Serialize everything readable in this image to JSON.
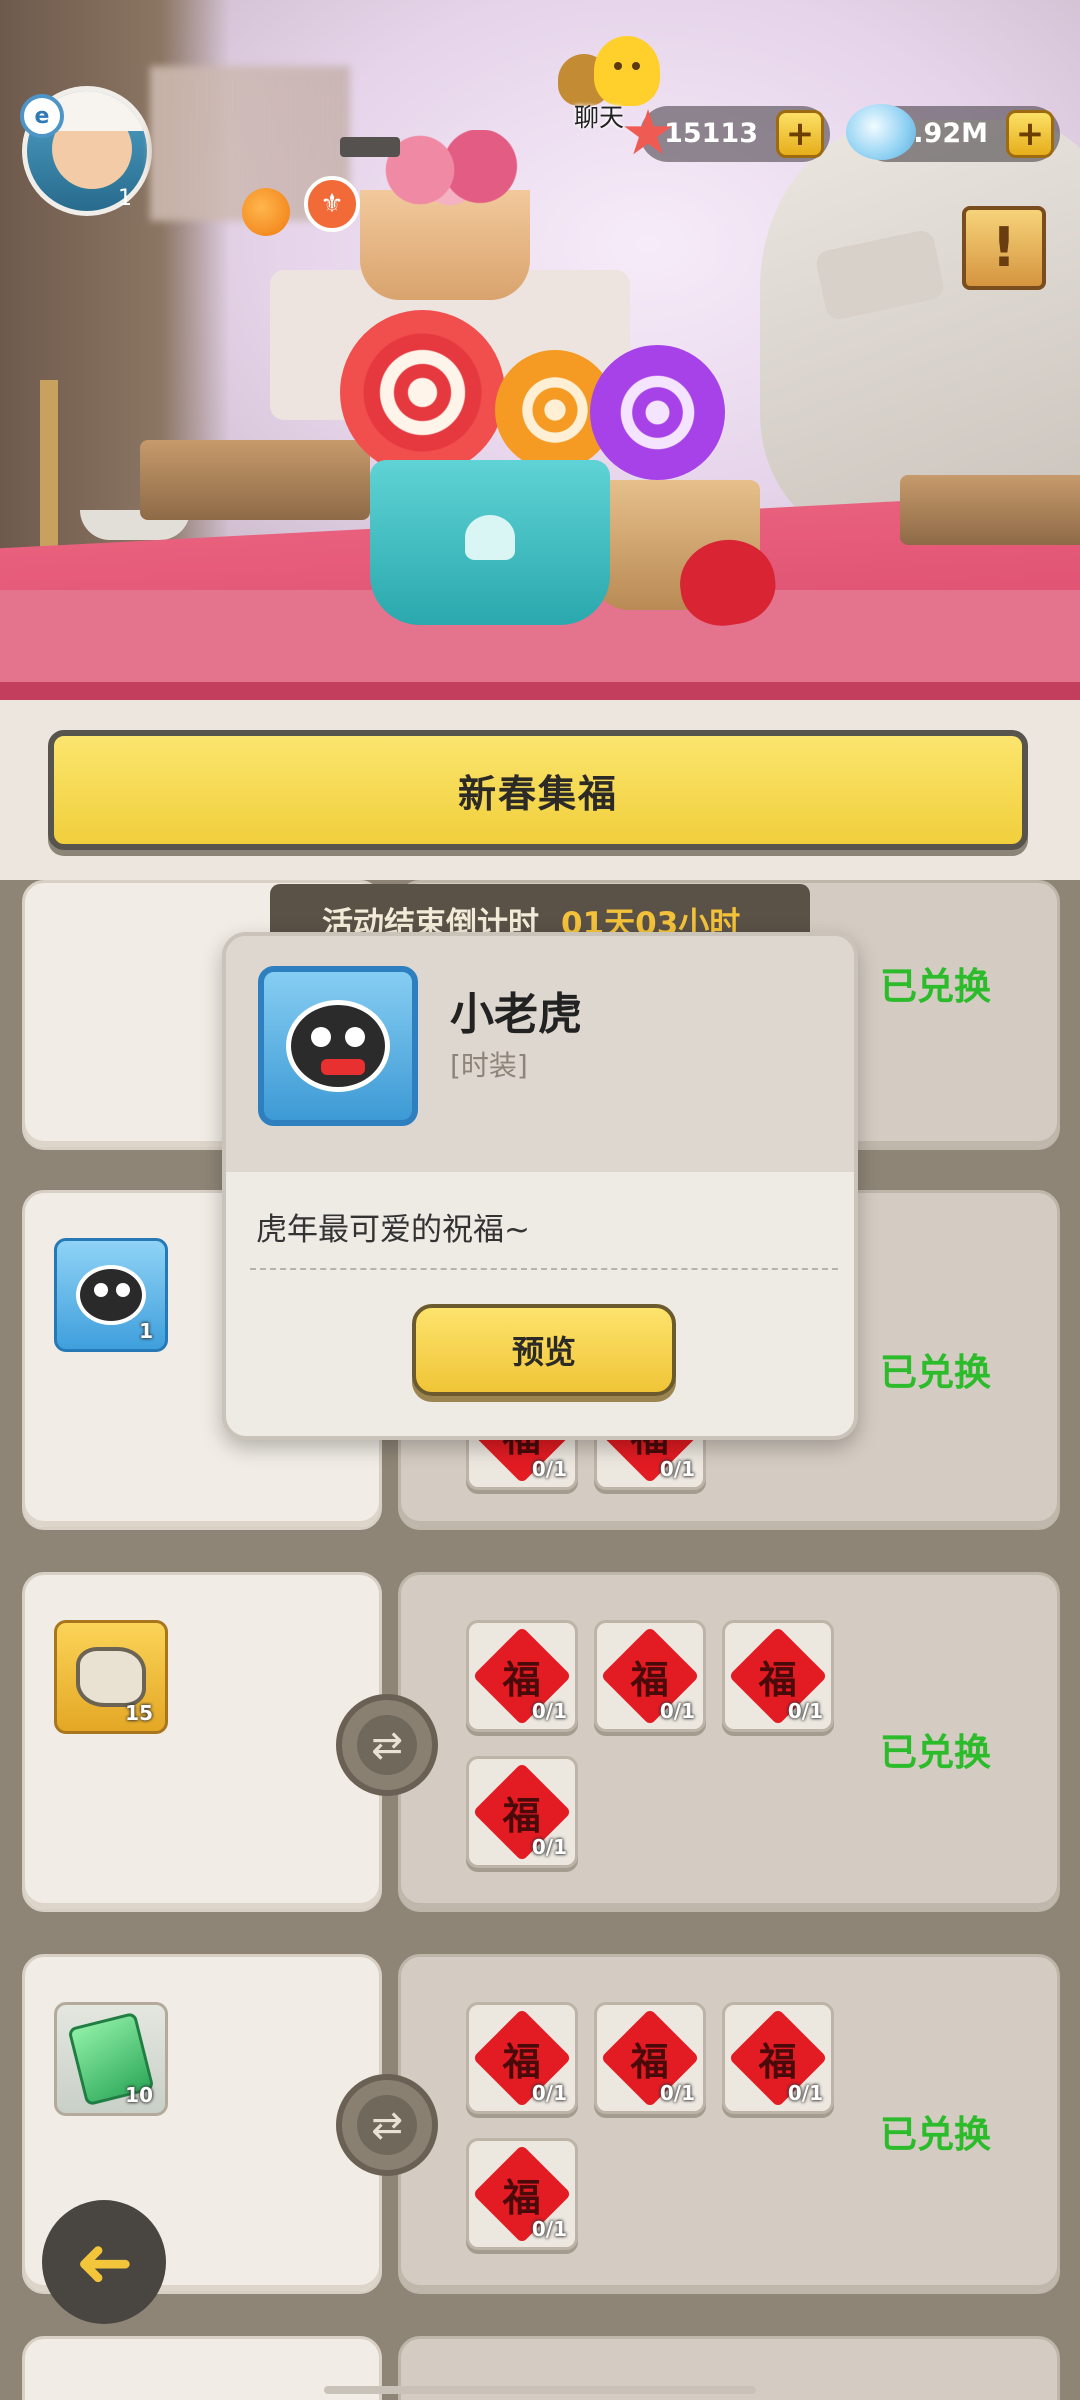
{
  "hud": {
    "level": "1",
    "chat_label": "聊天",
    "starfish": "15113",
    "gems": "9.92M",
    "plus": "+",
    "quest_mark": "!"
  },
  "banner": {
    "title": "新春集福"
  },
  "countdown": {
    "label": "活动结束倒计时",
    "value": "01天03小时"
  },
  "rows": [
    {
      "status": "已兑换"
    },
    {
      "reward_count": "1",
      "status": "已兑换",
      "tiles": [
        {
          "char": "福",
          "count": "0/1"
        },
        {
          "char": "福",
          "count": "0/1"
        }
      ]
    },
    {
      "reward_count": "15",
      "status": "已兑换",
      "tiles": [
        {
          "char": "福",
          "count": "0/1"
        },
        {
          "char": "福",
          "count": "0/1"
        },
        {
          "char": "福",
          "count": "0/1"
        },
        {
          "char": "福",
          "count": "0/1"
        }
      ]
    },
    {
      "reward_count": "10",
      "status": "已兑换",
      "tiles": [
        {
          "char": "福",
          "count": "0/1"
        },
        {
          "char": "福",
          "count": "0/1"
        },
        {
          "char": "福",
          "count": "0/1"
        },
        {
          "char": "福",
          "count": "0/1"
        }
      ]
    }
  ],
  "popup": {
    "title": "小老虎",
    "subtitle": "[时装]",
    "description": "虎年最可爱的祝福~",
    "button": "预览"
  },
  "icons": {
    "swap": "⇄",
    "back": "➜"
  }
}
